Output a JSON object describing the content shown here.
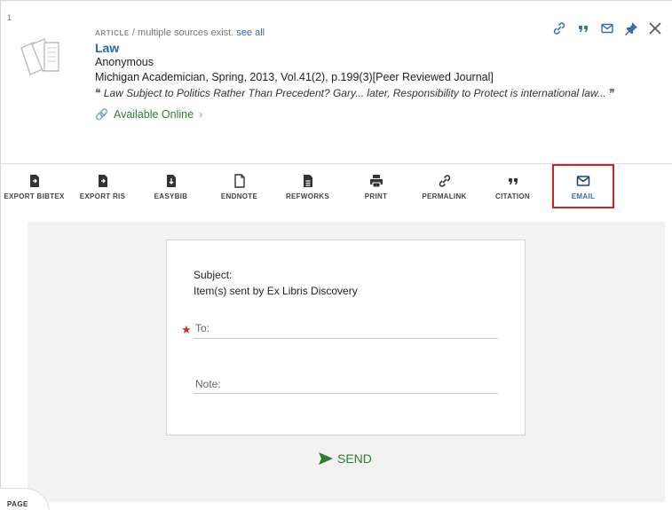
{
  "result": {
    "index": "1",
    "type_label": "ARTICLE",
    "type_rest": " / multiple sources exist. ",
    "see_all": "see all",
    "title": "Law",
    "author": "Anonymous",
    "source": "Michigan Academician, Spring, 2013, Vol.41(2), p.199(3)[Peer Reviewed Journal]",
    "snippet": "Law Subject to Politics Rather Than Precedent? Gary... later, Responsibility to Protect is international law...",
    "available": "Available Online"
  },
  "top_actions": [
    {
      "name": "permalink-icon"
    },
    {
      "name": "citation-icon"
    },
    {
      "name": "email-icon"
    },
    {
      "name": "pin-icon"
    },
    {
      "name": "close-icon"
    }
  ],
  "toolbar": {
    "items": [
      {
        "label": "EXPORT BIBTEX"
      },
      {
        "label": "EXPORT RIS"
      },
      {
        "label": "EASYBIB"
      },
      {
        "label": "ENDNOTE"
      },
      {
        "label": "REFWORKS"
      },
      {
        "label": "PRINT"
      },
      {
        "label": "PERMALINK"
      },
      {
        "label": "CITATION"
      },
      {
        "label": "EMAIL"
      }
    ]
  },
  "email_form": {
    "subject_label": "Subject:",
    "subject_value": "Item(s) sent by Ex Libris Discovery",
    "required_mark": "★",
    "to_label": "To:",
    "note_label": "Note:",
    "send_label": "SEND"
  },
  "page_tab": "PAGE",
  "colors": {
    "link": "#3a6ea5",
    "available": "#2e7d32",
    "highlight": "#d21f1f",
    "panel": "#f2f2f2"
  }
}
